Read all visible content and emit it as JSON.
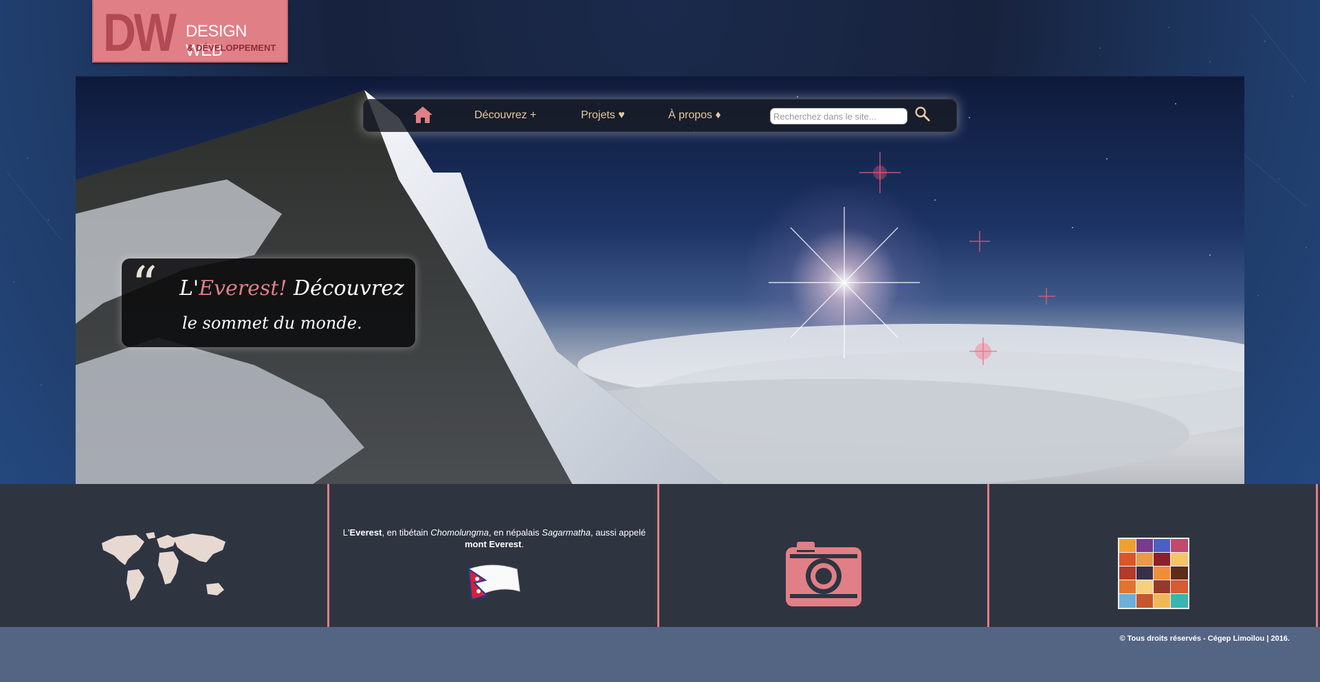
{
  "logo": {
    "initials": "DW",
    "line1": "DESIGN WEB",
    "line2": "& DÉVELOPPEMENT"
  },
  "nav": {
    "items": [
      {
        "label": "Découvrez +"
      },
      {
        "label": "Projets ♥"
      },
      {
        "label": "À propos ♦"
      }
    ],
    "search_placeholder": "Recherchez dans le site..."
  },
  "hero": {
    "quote_mark": "“",
    "quote_pre": "L'",
    "quote_accent": "Everest!",
    "quote_post": " Découvrez",
    "quote_line2": "le sommet du monde."
  },
  "features": {
    "text": {
      "p1": "L'",
      "b1": "Everest",
      "p2": ", en tibétain ",
      "i1": "Chomolungma",
      "p3": ", en népalais ",
      "i2": "Sagarmatha",
      "p4": ", aussi appelé ",
      "b2": "mont Everest",
      "p5": "."
    }
  },
  "footer": {
    "copyright": "© Tous droits réservés - Cégep Limoilou | 2016."
  },
  "colors": {
    "accent": "#e07f86",
    "band": "#2f3441",
    "footer": "#546483",
    "nav_text": "#e6c9a2"
  }
}
